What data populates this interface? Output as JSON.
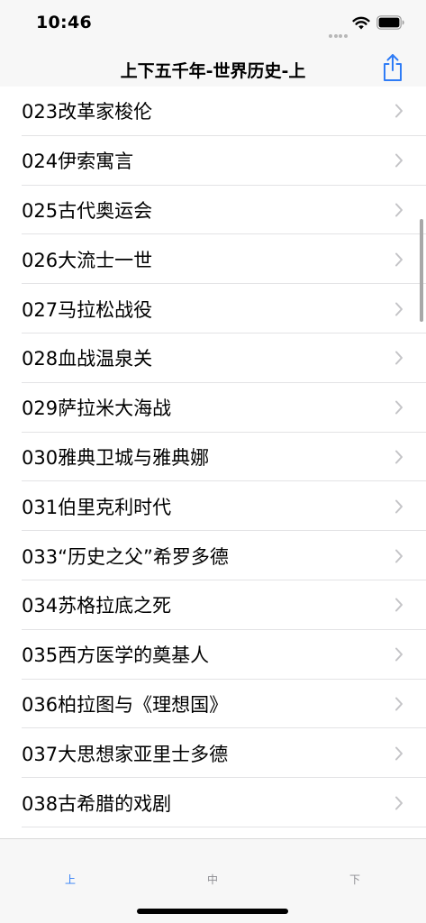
{
  "status_bar": {
    "time": "10:46"
  },
  "nav": {
    "title": "上下五千年-世界历史-上",
    "share_icon": "share-icon",
    "accent_color": "#2f7cf6"
  },
  "list": {
    "items": [
      {
        "label": "023改革家梭伦"
      },
      {
        "label": "024伊索寓言"
      },
      {
        "label": "025古代奥运会"
      },
      {
        "label": "026大流士一世"
      },
      {
        "label": "027马拉松战役"
      },
      {
        "label": "028血战温泉关"
      },
      {
        "label": "029萨拉米大海战"
      },
      {
        "label": "030雅典卫城与雅典娜"
      },
      {
        "label": "031伯里克利时代"
      },
      {
        "label": "033“历史之父”希罗多德"
      },
      {
        "label": "034苏格拉底之死"
      },
      {
        "label": "035西方医学的奠基人"
      },
      {
        "label": "036柏拉图与《理想国》"
      },
      {
        "label": "037大思想家亚里士多德"
      },
      {
        "label": "038古希腊的戏剧"
      }
    ]
  },
  "tab_bar": {
    "tabs": [
      {
        "label": "上",
        "active": true
      },
      {
        "label": "中",
        "active": false
      },
      {
        "label": "下",
        "active": false
      }
    ]
  }
}
